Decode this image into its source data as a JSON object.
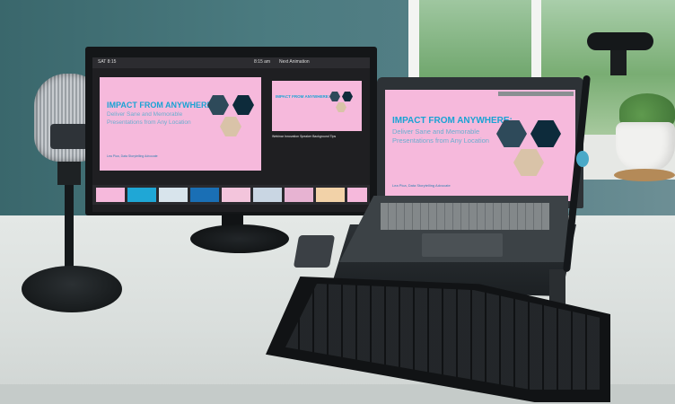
{
  "presenter_view": {
    "slide_counter": "SAT 8:15",
    "elapsed": "8:15 am",
    "next_label": "Next Animation",
    "notes_text": "Webinar Innovation Speaker Background Tips",
    "slide": {
      "title": "IMPACT FROM ANYWHERE:",
      "subtitle_line1": "Deliver Sane and Memorable",
      "subtitle_line2": "Presentations from Any Location",
      "author": "Lea Pica, Data Storytelling Advocate"
    }
  },
  "laptop_slide": {
    "title": "IMPACT FROM ANYWHERE:",
    "subtitle_line1": "Deliver Sane and Memorable",
    "subtitle_line2": "Presentations from Any Location",
    "author": "Lea Pica, Data Storytelling Advocate"
  },
  "colors": {
    "wall": "#3e6d72",
    "desk": "#e8ece9",
    "slide_bg": "#f6b9dc",
    "title_blue": "#1aa3d4"
  },
  "objects": [
    "microphone",
    "external-monitor",
    "laptop",
    "laptop-stand",
    "keyboard",
    "webcam",
    "succulent-plant",
    "window"
  ]
}
